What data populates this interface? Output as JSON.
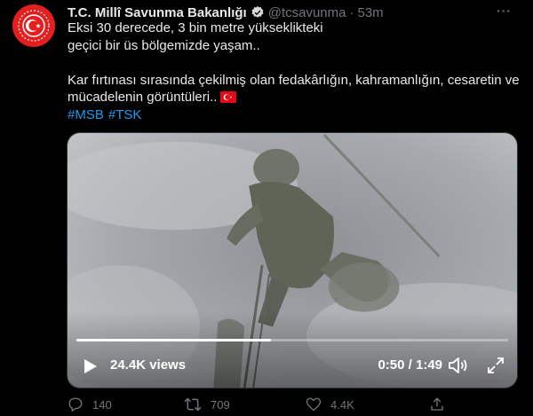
{
  "tweet": {
    "author_name": "T.C. Millî Savunma Bakanlığı",
    "handle": "@tcsavunma",
    "separator": "·",
    "time": "53m",
    "more_label": "···",
    "lines": [
      "Eksi 30 derecede, 3 bin metre yükseklikteki",
      "geçici bir üs bölgemizde yaşam..",
      "Kar fırtınası sırasında çekilmiş olan fedakârlığın, kahramanlığın, cesaretin ve",
      "mücadelenin görüntüleri.."
    ],
    "hashtags": [
      "#MSB",
      "#TSK"
    ],
    "flag_icon": "turkey-flag-icon"
  },
  "video": {
    "views": "24.4K views",
    "time": "0:50 / 1:49",
    "progress": 0.45
  },
  "actions": {
    "replies": "140",
    "retweets": "709",
    "likes": "4.4K"
  },
  "colors": {
    "background": "#000000",
    "text": "#e7e9ea",
    "muted": "#71767b",
    "link": "#1d9bf0",
    "avatar": "#e3201f"
  }
}
